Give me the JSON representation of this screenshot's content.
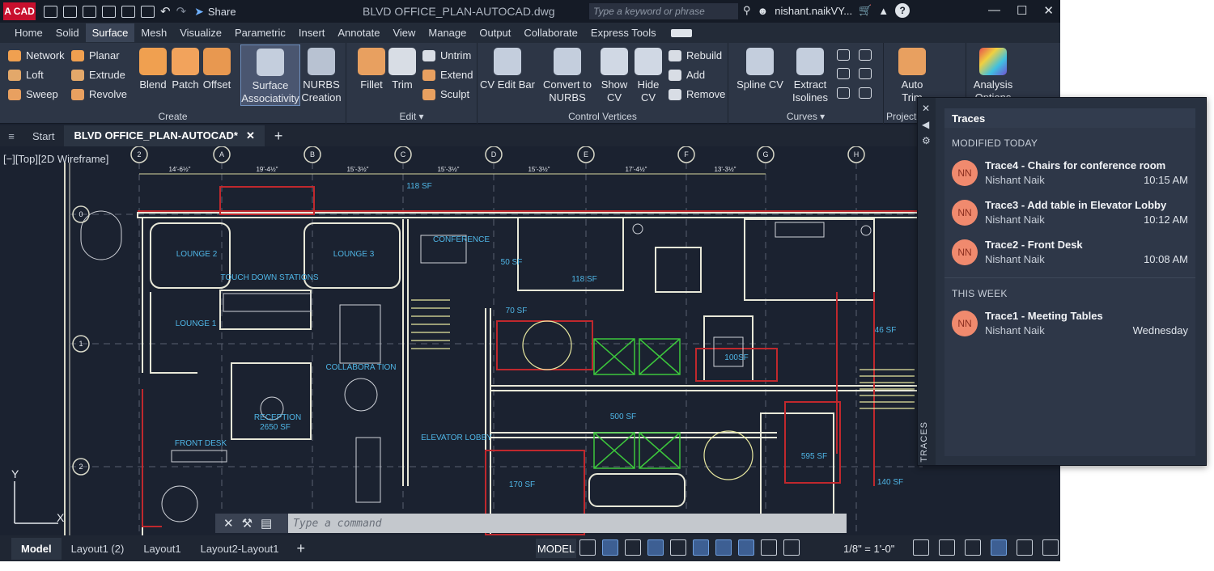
{
  "titlebar": {
    "logo": "A CAD",
    "share_label": "Share",
    "doc_title": "BLVD OFFICE_PLAN-AUTOCAD.dwg",
    "search_placeholder": "Type a keyword or phrase",
    "user": "nishant.naikVY...",
    "help": "?"
  },
  "menu_tabs": [
    "Home",
    "Solid",
    "Surface",
    "Mesh",
    "Visualize",
    "Parametric",
    "Insert",
    "Annotate",
    "View",
    "Manage",
    "Output",
    "Collaborate",
    "Express Tools"
  ],
  "active_menu_tab": "Surface",
  "ribbon": {
    "create": {
      "title": "Create",
      "small": [
        "Network",
        "Loft",
        "Sweep",
        "Planar",
        "Extrude",
        "Revolve"
      ],
      "big": [
        "Blend",
        "Patch",
        "Offset"
      ],
      "surface_assoc": [
        "Surface",
        "Associativity"
      ],
      "nurbs": [
        "NURBS",
        "Creation"
      ]
    },
    "edit": {
      "title": "Edit",
      "big": [
        "Fillet",
        "Trim"
      ],
      "small": [
        "Untrim",
        "Extend",
        "Sculpt"
      ]
    },
    "control_vertices": {
      "title": "Control Vertices",
      "cv_edit_bar": "CV Edit Bar",
      "convert": [
        "Convert to",
        "NURBS"
      ],
      "show_cv": [
        "Show",
        "CV"
      ],
      "hide_cv": [
        "Hide",
        "CV"
      ],
      "small": [
        "Rebuild",
        "Add",
        "Remove"
      ]
    },
    "curves": {
      "title": "Curves",
      "spline_cv": "Spline CV",
      "extract": [
        "Extract",
        "Isolines"
      ]
    },
    "project": {
      "title": "Project",
      "auto_trim": [
        "Auto",
        "Trim"
      ]
    },
    "analysis": [
      "Analysis",
      "Options"
    ]
  },
  "doc_tabs": {
    "start": "Start",
    "active": "BLVD OFFICE_PLAN-AUTOCAD*"
  },
  "viewport_label": "[−][Top][2D Wireframe]",
  "drawing": {
    "grid_top": [
      "2",
      "A",
      "B",
      "C",
      "D",
      "E",
      "F",
      "G",
      "H"
    ],
    "grid_left": [
      "0",
      "1",
      "2"
    ],
    "dims": [
      "14'-6½\"",
      "19'-4½\"",
      "15'-3½\"",
      "15'-3½\"",
      "15'-3½\"",
      "17'-4½\"",
      "13'-3½\""
    ],
    "labels": [
      "118 SF",
      "LOUNGE 2",
      "LOUNGE 3",
      "CONFERENCE",
      "50 SF",
      "118 SF",
      "TOUCH DOWN STATIONS",
      "LOUNGE 1",
      "70 SF",
      "COLLABORA TION",
      "100SF",
      "RECEPTION",
      "2650 SF",
      "FRONT DESK",
      "500 SF",
      "ELEVATOR LOBBY",
      "170 SF",
      "595 SF",
      "46 SF",
      "140 SF"
    ],
    "ucs_y": "Y",
    "ucs_x": "X"
  },
  "command_line": {
    "placeholder": "Type a command"
  },
  "statusbar": {
    "tabs": [
      "Model",
      "Layout1 (2)",
      "Layout1",
      "Layout2-Layout1"
    ],
    "model_btn": "MODEL",
    "scale": "1/8\" = 1'-0\""
  },
  "traces_panel": {
    "side_label": "TRACES",
    "title": "Traces",
    "sections": [
      {
        "heading": "MODIFIED TODAY",
        "items": [
          {
            "initials": "NN",
            "title": "Trace4 - Chairs for conference room",
            "author": "Nishant Naik",
            "time": "10:15 AM"
          },
          {
            "initials": "NN",
            "title": "Trace3 - Add table in Elevator Lobby",
            "author": "Nishant Naik",
            "time": "10:12 AM"
          },
          {
            "initials": "NN",
            "title": "Trace2 - Front Desk",
            "author": "Nishant Naik",
            "time": "10:08 AM"
          }
        ]
      },
      {
        "heading": "THIS WEEK",
        "items": [
          {
            "initials": "NN",
            "title": "Trace1 - Meeting Tables",
            "author": "Nishant Naik",
            "time": "Wednesday"
          }
        ]
      }
    ]
  },
  "colors": {
    "bg": "#1b2230",
    "wall": "#e8e8d8",
    "red": "#c0282d",
    "label": "#4fb6e6",
    "green": "#3cc63c",
    "avatar": "#f08a6e"
  }
}
